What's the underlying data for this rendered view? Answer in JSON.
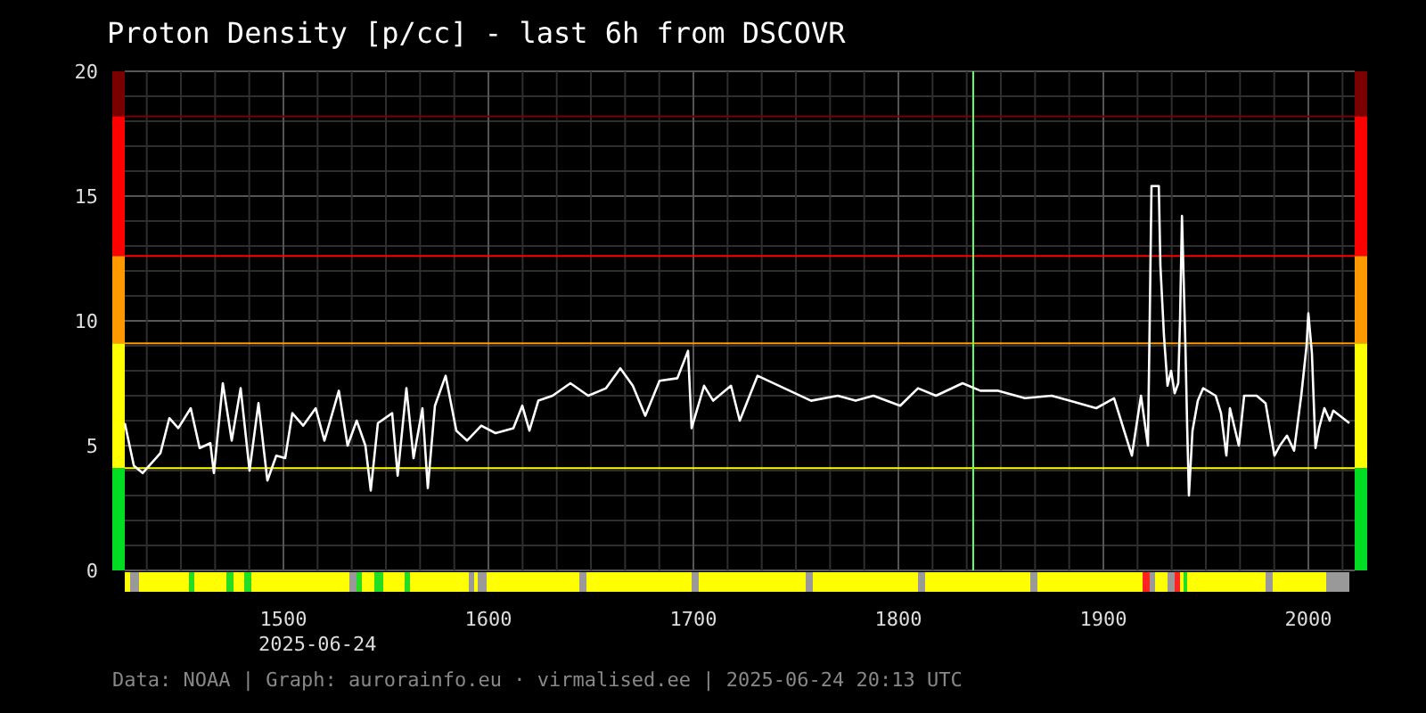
{
  "title": "Proton Density [p/cc] - last 6h from DSCOVR",
  "chart": {
    "date_label": "2025-06-24",
    "chart_data": {
      "type": "line",
      "xlim": [
        1422.6,
        2022.6
      ],
      "ylim": [
        0,
        20
      ],
      "xticks": [
        1500,
        1600,
        1700,
        1800,
        1900,
        2000
      ],
      "yticks": [
        0,
        5,
        10,
        15,
        20
      ],
      "x": [
        1422.6,
        1427,
        1431.3,
        1440,
        1444.3,
        1448.7,
        1454.8,
        1459.1,
        1464.3,
        1466.1,
        1470.4,
        1474.8,
        1479.1,
        1483.5,
        1487.8,
        1492.2,
        1496.5,
        1500.9,
        1504.3,
        1509.6,
        1515.7,
        1520,
        1527,
        1531.3,
        1535.7,
        1540,
        1542.6,
        1546.1,
        1553,
        1555.7,
        1560,
        1563.5,
        1567.8,
        1570.4,
        1573.9,
        1579.1,
        1584.3,
        1589.6,
        1596.5,
        1603.5,
        1612.2,
        1616.5,
        1620,
        1624.3,
        1631.3,
        1640,
        1648.7,
        1657.4,
        1664.3,
        1670.4,
        1676.5,
        1683.5,
        1692.2,
        1697.4,
        1699.1,
        1705.2,
        1709.6,
        1718.3,
        1722.6,
        1731.3,
        1744.3,
        1757.4,
        1770.4,
        1779.1,
        1787.8,
        1800.9,
        1809.6,
        1818.3,
        1831.3,
        1840,
        1848.7,
        1861.7,
        1874.8,
        1883.5,
        1896.5,
        1905.2,
        1913.9,
        1918.3,
        1921.7,
        1922.6,
        1923.5,
        1927,
        1927.8,
        1929.6,
        1931.3,
        1933,
        1934.8,
        1936.5,
        1937.4,
        1938.3,
        1940,
        1940.9,
        1941.7,
        1943.5,
        1946.1,
        1948.7,
        1954.8,
        1957.4,
        1960,
        1961.7,
        1966.1,
        1968.7,
        1974.8,
        1979.1,
        1983.5,
        1986.1,
        1989.6,
        1993,
        1996.5,
        1999.1,
        2000,
        2001.7,
        2003.5,
        2005.2,
        2007.8,
        2010.4,
        2012.2,
        2020
      ],
      "series": [
        {
          "color": "#ffffff",
          "values": [
            5.9,
            4.2,
            3.9,
            4.7,
            6.1,
            5.7,
            6.5,
            4.9,
            5.1,
            3.9,
            7.5,
            5.2,
            7.3,
            4.0,
            6.7,
            3.6,
            4.6,
            4.5,
            6.3,
            5.8,
            6.5,
            5.2,
            7.2,
            5.0,
            6.0,
            5.0,
            3.2,
            5.9,
            6.3,
            3.8,
            7.3,
            4.5,
            6.5,
            3.3,
            6.6,
            7.8,
            5.6,
            5.2,
            5.8,
            5.5,
            5.7,
            6.6,
            5.6,
            6.8,
            7.0,
            7.5,
            7.0,
            7.3,
            8.1,
            7.4,
            6.2,
            7.6,
            7.7,
            8.8,
            5.7,
            7.4,
            6.8,
            7.4,
            6.0,
            7.8,
            7.3,
            6.8,
            7.0,
            6.8,
            7.0,
            6.6,
            7.3,
            7.0,
            7.5,
            7.2,
            7.2,
            6.9,
            7.0,
            6.8,
            6.5,
            6.9,
            4.6,
            7.0,
            5.0,
            10.0,
            15.4,
            15.4,
            12.2,
            9.4,
            7.4,
            8.0,
            7.1,
            7.5,
            10.0,
            14.2,
            9.1,
            5.8,
            3.0,
            5.6,
            6.8,
            7.3,
            7.0,
            6.3,
            4.6,
            6.5,
            5.0,
            7.0,
            7.0,
            6.7,
            4.6,
            5.0,
            5.4,
            4.8,
            7.0,
            9.0,
            10.3,
            8.7,
            4.9,
            5.7,
            6.5,
            6.0,
            6.4,
            5.9
          ]
        }
      ],
      "grid": true,
      "ref_lines": [
        {
          "axis": "y",
          "value": 4.1,
          "color": "#ffff00"
        },
        {
          "axis": "y",
          "value": 9.1,
          "color": "#ff9900"
        },
        {
          "axis": "y",
          "value": 12.6,
          "color": "#ff0000"
        },
        {
          "axis": "y",
          "value": 18.2,
          "color": "#7a0000"
        },
        {
          "axis": "x",
          "value": 1836.5,
          "color": "#66ff66"
        }
      ]
    }
  },
  "footer": "Data: NOAA | Graph: aurorainfo.eu · virmalised.ee | 2025-06-24 20:13 UTC"
}
